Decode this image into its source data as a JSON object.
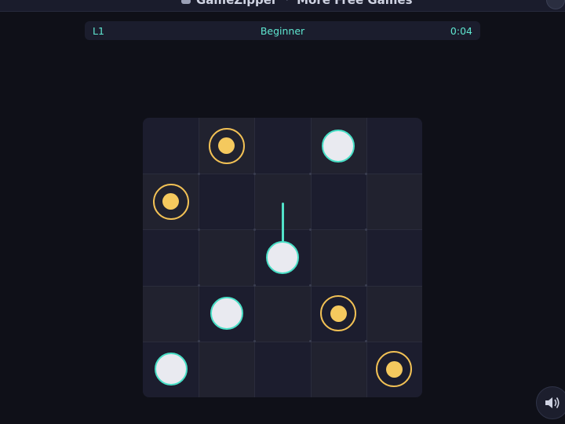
{
  "topbar": {
    "brand": "GameZipper",
    "separator": "·",
    "link": "More Free Games"
  },
  "hud": {
    "level": "L1",
    "difficulty": "Beginner",
    "timer": "0:04"
  },
  "hint": "",
  "board": {
    "rows": 5,
    "cols": 5,
    "balls": [
      {
        "row": 0,
        "col": 3
      },
      {
        "row": 2,
        "col": 2
      },
      {
        "row": 3,
        "col": 1
      },
      {
        "row": 4,
        "col": 0
      }
    ],
    "targets": [
      {
        "row": 0,
        "col": 1
      },
      {
        "row": 1,
        "col": 0
      },
      {
        "row": 3,
        "col": 3
      },
      {
        "row": 4,
        "col": 4
      }
    ],
    "aim": {
      "row": 2,
      "col": 2,
      "direction": "up"
    }
  },
  "colors": {
    "accent": "#48dfc6",
    "target": "#f2c155",
    "ball": "#e9eaf0",
    "background": "#0f1018"
  },
  "icons": {
    "logo": "gamepad-icon",
    "sound": "speaker-icon"
  }
}
